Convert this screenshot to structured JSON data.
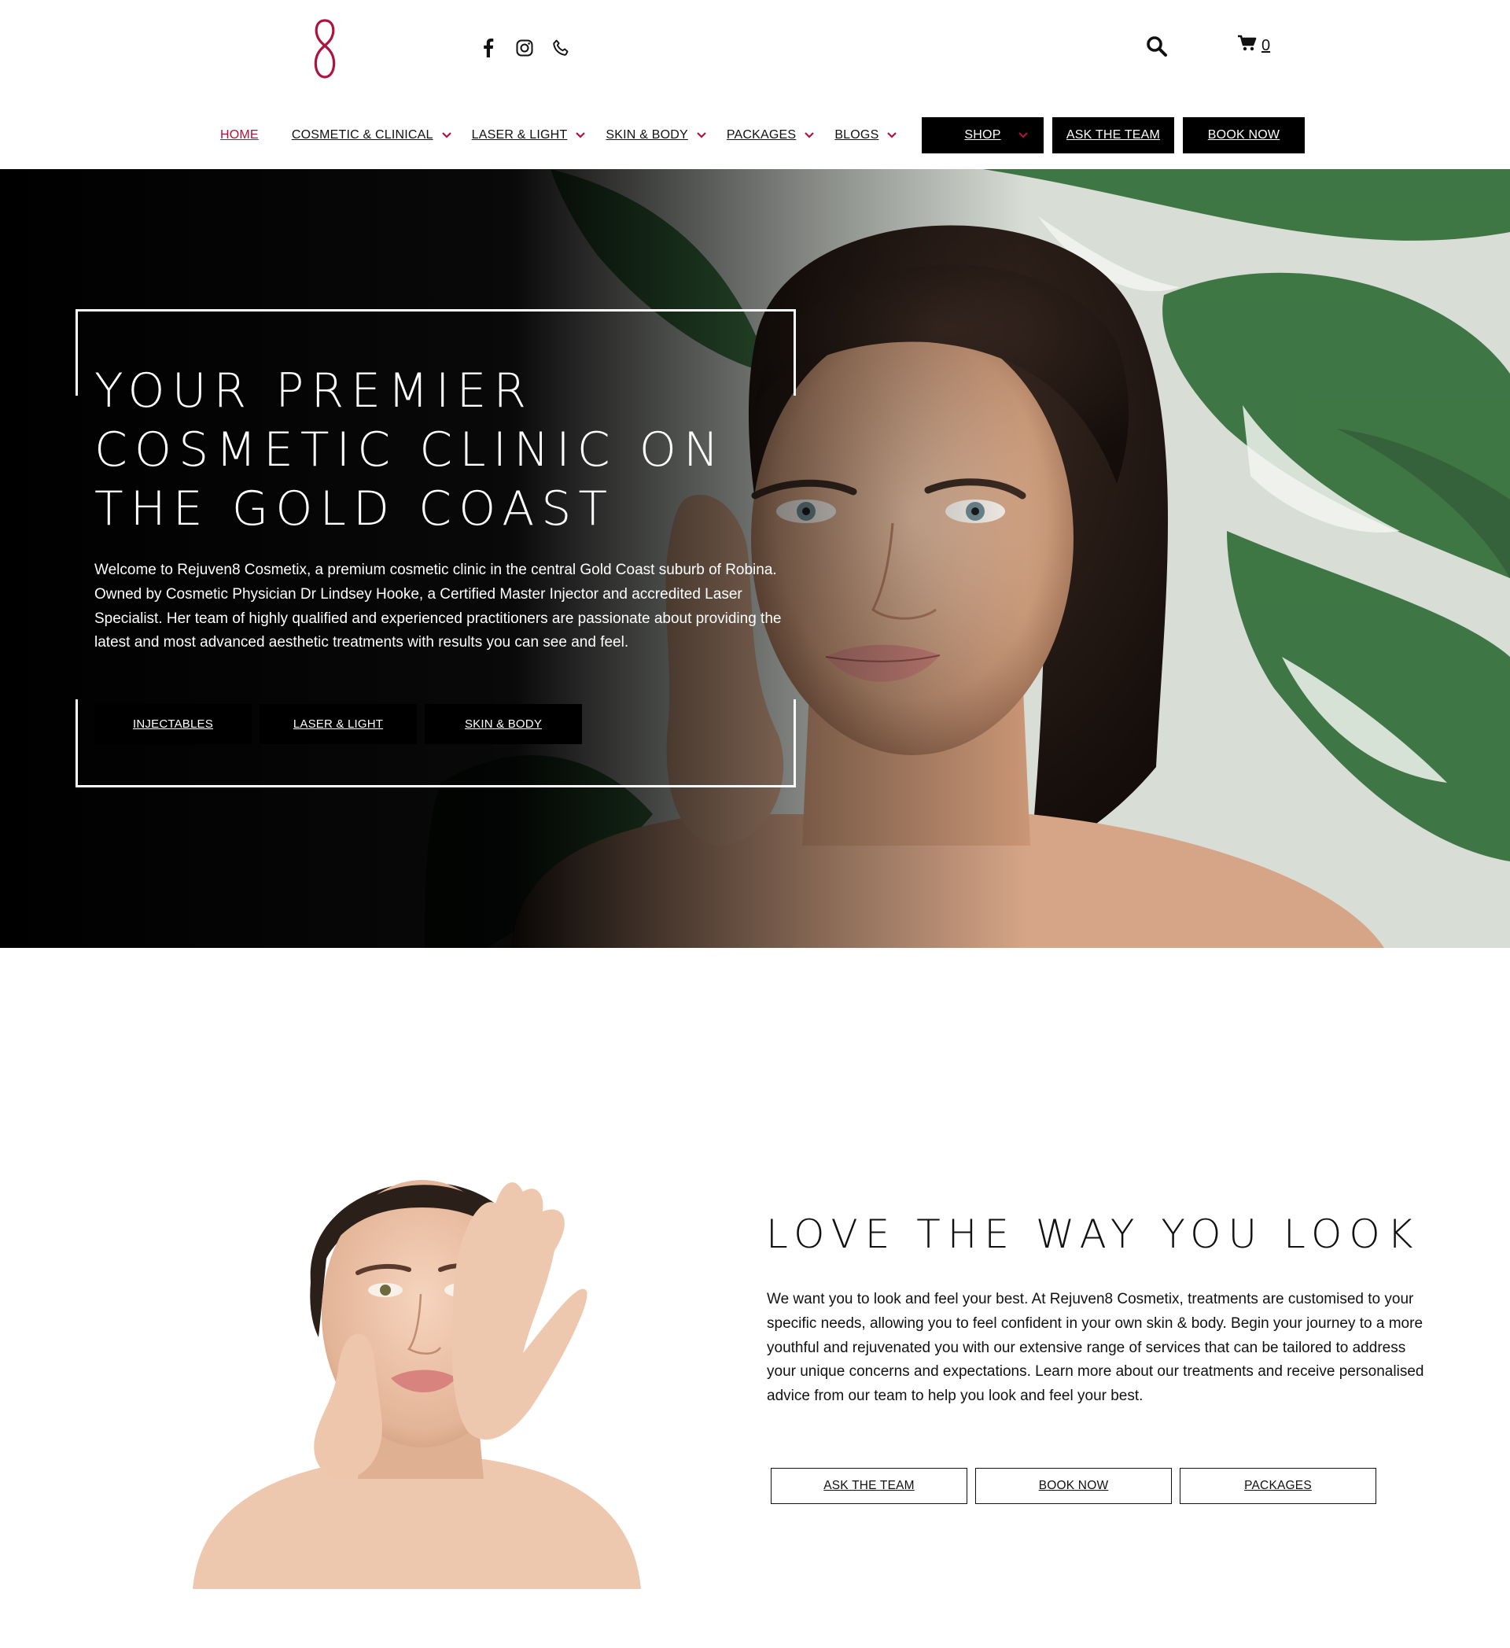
{
  "header": {
    "logo_alt": "Rejuven8 Cosmetix logo",
    "social": [
      {
        "icon": "facebook-icon"
      },
      {
        "icon": "instagram-icon"
      },
      {
        "icon": "phone-icon"
      }
    ],
    "cart_count": "0"
  },
  "nav": {
    "items": [
      {
        "label": "HOME",
        "active": true
      },
      {
        "label": "COSMETIC & CLINICAL",
        "dropdown": true
      },
      {
        "label": "LASER & LIGHT",
        "dropdown": true
      },
      {
        "label": "SKIN & BODY",
        "dropdown": true
      },
      {
        "label": "PACKAGES",
        "dropdown": true
      },
      {
        "label": "BLOGS",
        "dropdown": true
      }
    ],
    "shop_label": "SHOP",
    "ask_label": "ASK THE TEAM",
    "book_label": "BOOK NOW"
  },
  "hero": {
    "title_lines": [
      "YOUR PREMIER",
      "COSMETIC CLINIC ON",
      "THE GOLD COAST"
    ],
    "text": "Welcome to Rejuven8 Cosmetix, a premium cosmetic clinic in the central Gold Coast suburb of Robina. Owned by Cosmetic Physician Dr Lindsey Hooke, a Certified Master Injector and accredited Laser Specialist. Her team of highly qualified and experienced practitioners are passionate about providing the latest and most advanced aesthetic treatments with results you can see and feel.",
    "buttons": [
      "INJECTABLES",
      "LASER & LIGHT",
      "SKIN & BODY"
    ]
  },
  "love": {
    "title": "LOVE THE WAY YOU LOOK",
    "text": "We want you to look and feel your best. At Rejuven8 Cosmetix, treatments are customised to your specific needs, allowing you to feel confident in your own skin & body. Begin your journey to a more youthful and rejuvenated you with our extensive range of services that can be tailored to address your unique concerns and expectations. Learn more about our treatments and receive personalised advice from our team to help you look and feel your best.",
    "buttons": [
      "ASK THE TEAM",
      "BOOK NOW",
      "PACKAGES"
    ]
  },
  "colors": {
    "accent": "#b0123f",
    "button_bg": "#000000",
    "button_text": "#ffffff"
  }
}
